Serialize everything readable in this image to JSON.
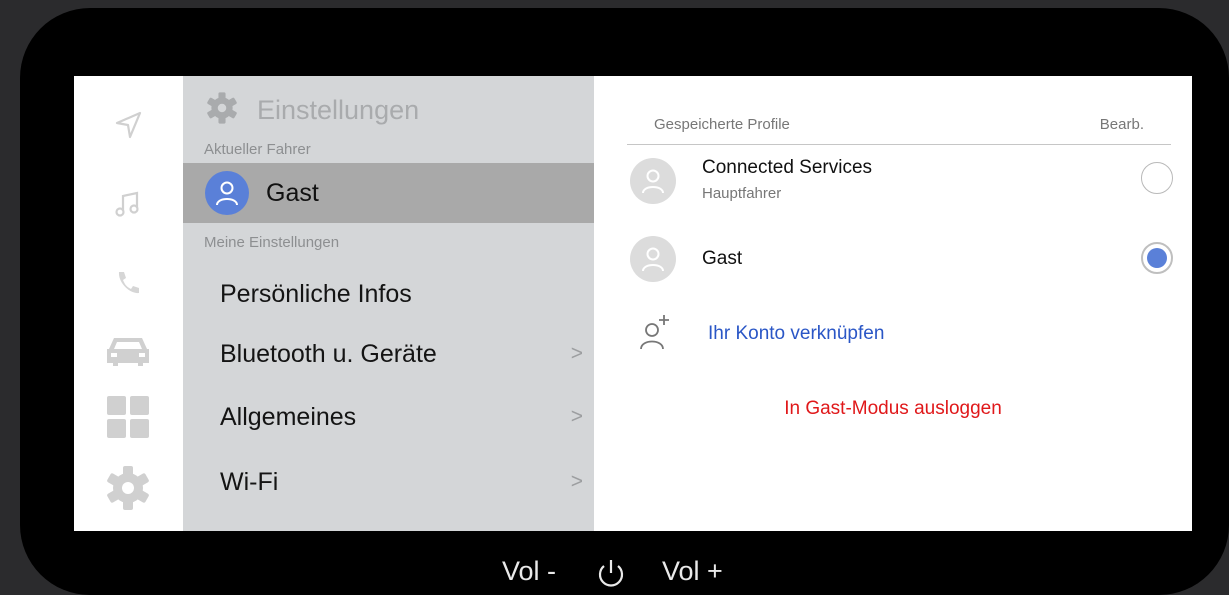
{
  "rail": {
    "icons": [
      "navigation-icon",
      "music-icon",
      "phone-icon",
      "car-icon",
      "apps-grid-icon",
      "settings-gear-icon"
    ]
  },
  "settings": {
    "title": "Einstellungen",
    "current_driver_label": "Aktueller Fahrer",
    "current_driver_name": "Gast",
    "my_settings_label": "Meine Einstellungen",
    "menu": [
      {
        "label": "Persönliche Infos",
        "chevron": ""
      },
      {
        "label": "Bluetooth u. Geräte",
        "chevron": ">"
      },
      {
        "label": "Allgemeines",
        "chevron": ">"
      },
      {
        "label": "Wi-Fi",
        "chevron": ">"
      }
    ]
  },
  "profiles": {
    "header_left": "Gespeicherte Profile",
    "header_right": "Bearb.",
    "items": [
      {
        "name": "Connected Services",
        "sub": "Hauptfahrer",
        "selected": false
      },
      {
        "name": "Gast",
        "sub": "",
        "selected": true
      }
    ],
    "link_account": "Ihr Konto verknüpfen",
    "logout_guest": "In Gast-Modus ausloggen"
  },
  "hardware": {
    "vol_minus": "Vol -",
    "vol_plus": "Vol +"
  },
  "colors": {
    "accent_blue": "#5a80d8",
    "link_blue": "#2a56c6",
    "danger_red": "#e0181a",
    "panel_grey": "#d4d6d8",
    "highlight_grey": "#a9a9a9"
  }
}
